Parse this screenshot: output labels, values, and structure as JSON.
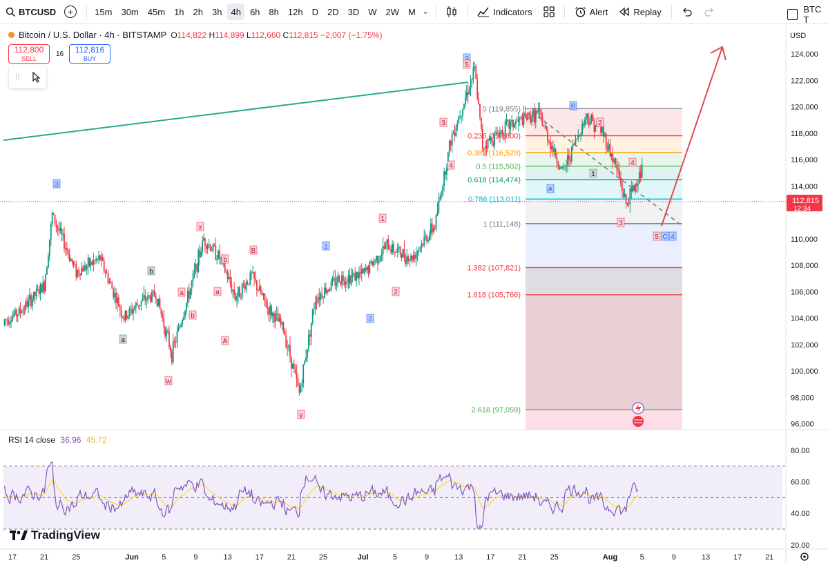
{
  "toolbar": {
    "symbol": "BTCUSD",
    "intervals": [
      "15m",
      "30m",
      "45m",
      "1h",
      "2h",
      "3h",
      "4h",
      "6h",
      "8h",
      "12h",
      "D",
      "2D",
      "3D",
      "W",
      "2W",
      "M"
    ],
    "active_interval": "4h",
    "indicators_label": "Indicators",
    "alert_label": "Alert",
    "replay_label": "Replay",
    "right_label": "BTC T"
  },
  "legend": {
    "title": "Bitcoin / U.S. Dollar · 4h · BITSTAMP",
    "open_label": "O",
    "open": "114,822",
    "high_label": "H",
    "high": "114,899",
    "low_label": "L",
    "low": "112,660",
    "close_label": "C",
    "close": "112,815",
    "change": "−2,007 (−1.75%)"
  },
  "trade": {
    "sell_price": "112,800",
    "sell_label": "SELL",
    "spread": "16",
    "buy_price": "112,816",
    "buy_label": "BUY"
  },
  "price_axis": {
    "currency": "USD",
    "ticks": [
      "124,000",
      "122,000",
      "120,000",
      "118,000",
      "116,000",
      "114,000",
      "112,000",
      "110,000",
      "108,000",
      "106,000",
      "104,000",
      "102,000",
      "100,000",
      "98,000",
      "96,000"
    ],
    "current_price": "112,815",
    "countdown": "12:34"
  },
  "time_axis": {
    "ticks": [
      "17",
      "21",
      "25",
      "Jun",
      "5",
      "9",
      "13",
      "17",
      "21",
      "25",
      "Jul",
      "5",
      "9",
      "13",
      "17",
      "21",
      "25",
      "Aug",
      "5",
      "9",
      "13",
      "17",
      "21"
    ]
  },
  "fib_levels": [
    {
      "label": "0 (119,855)",
      "color": "#787b86"
    },
    {
      "label": "0.236 (117,800)",
      "color": "#f23645"
    },
    {
      "label": "0.382 (116,529)",
      "color": "#ff9800"
    },
    {
      "label": "0.5 (115,502)",
      "color": "#4caf50"
    },
    {
      "label": "0.618 (114,474)",
      "color": "#089981"
    },
    {
      "label": "0.786 (113,011)",
      "color": "#00bcd4"
    },
    {
      "label": "1 (111,148)",
      "color": "#787b86"
    },
    {
      "label": "1.382 (107,821)",
      "color": "#f23645"
    },
    {
      "label": "1.618 (105,766)",
      "color": "#f23645"
    },
    {
      "label": "2.618 (97,059)",
      "color": "#4caf50"
    }
  ],
  "wave_labels": [
    {
      "text": "3",
      "style": "blue"
    },
    {
      "text": "5",
      "style": "red"
    },
    {
      "text": "3",
      "style": "red"
    },
    {
      "text": "4",
      "style": "red"
    },
    {
      "text": "B",
      "style": "blue"
    },
    {
      "text": "2",
      "style": "red"
    },
    {
      "text": "4",
      "style": "red"
    },
    {
      "text": "1",
      "style": "gray"
    },
    {
      "text": "A",
      "style": "blue"
    },
    {
      "text": "3",
      "style": "red"
    },
    {
      "text": "5",
      "style": "red"
    },
    {
      "text": "C",
      "style": "blue"
    },
    {
      "text": "4",
      "style": "blue"
    },
    {
      "text": "3",
      "style": "blue"
    },
    {
      "text": "x",
      "style": "red"
    },
    {
      "text": "b",
      "style": "red"
    },
    {
      "text": "B",
      "style": "red"
    },
    {
      "text": "a",
      "style": "red"
    },
    {
      "text": "b",
      "style": "red"
    },
    {
      "text": "b",
      "style": "gray"
    },
    {
      "text": "a",
      "style": "gray"
    },
    {
      "text": "a",
      "style": "red"
    },
    {
      "text": "A",
      "style": "red"
    },
    {
      "text": "w",
      "style": "red"
    },
    {
      "text": "y",
      "style": "red"
    },
    {
      "text": "1",
      "style": "blue"
    },
    {
      "text": "1",
      "style": "red"
    },
    {
      "text": "2",
      "style": "red"
    },
    {
      "text": "2",
      "style": "blue"
    }
  ],
  "rsi": {
    "label": "RSI 14 close",
    "value1": "36.96",
    "value2": "45.72",
    "ticks": [
      "80.00",
      "60.00",
      "40.00",
      "20.00"
    ]
  },
  "branding": {
    "name": "TradingView"
  },
  "colors": {
    "up": "#089981",
    "down": "#f23645",
    "rsi_line": "#7e57c2",
    "rsi_ma": "#fdd835",
    "trend": "#22ab94",
    "arrow": "#e0484f"
  },
  "chart_data": {
    "type": "candlestick",
    "symbol": "BTCUSD",
    "interval": "4h",
    "ylim": [
      96000,
      125000
    ],
    "close_path": [
      {
        "x": "May 15",
        "y": 103500
      },
      {
        "x": "May 18",
        "y": 104500
      },
      {
        "x": "May 21",
        "y": 106500
      },
      {
        "x": "May 22",
        "y": 111800
      },
      {
        "x": "May 25",
        "y": 107500
      },
      {
        "x": "May 28",
        "y": 108500
      },
      {
        "x": "May 31",
        "y": 104000
      },
      {
        "x": "Jun 2",
        "y": 105200
      },
      {
        "x": "Jun 4",
        "y": 105800
      },
      {
        "x": "Jun 6",
        "y": 101300
      },
      {
        "x": "Jun 8",
        "y": 105500
      },
      {
        "x": "Jun 10",
        "y": 110000
      },
      {
        "x": "Jun 12",
        "y": 108600
      },
      {
        "x": "Jun 14",
        "y": 105600
      },
      {
        "x": "Jun 16",
        "y": 107200
      },
      {
        "x": "Jun 18",
        "y": 104800
      },
      {
        "x": "Jun 20",
        "y": 103200
      },
      {
        "x": "Jun 22",
        "y": 98300
      },
      {
        "x": "Jun 24",
        "y": 105500
      },
      {
        "x": "Jun 27",
        "y": 107000
      },
      {
        "x": "Jun 30",
        "y": 107300
      },
      {
        "x": "Jul 3",
        "y": 109500
      },
      {
        "x": "Jul 6",
        "y": 108500
      },
      {
        "x": "Jul 9",
        "y": 111000
      },
      {
        "x": "Jul 11",
        "y": 117500
      },
      {
        "x": "Jul 14",
        "y": 122800
      },
      {
        "x": "Jul 15",
        "y": 117000
      },
      {
        "x": "Jul 18",
        "y": 118500
      },
      {
        "x": "Jul 22",
        "y": 119500
      },
      {
        "x": "Jul 25",
        "y": 115000
      },
      {
        "x": "Jul 28",
        "y": 119300
      },
      {
        "x": "Jul 30",
        "y": 118200
      },
      {
        "x": "Aug 1",
        "y": 115000
      },
      {
        "x": "Aug 2",
        "y": 112600
      },
      {
        "x": "Aug 4",
        "y": 115200
      },
      {
        "x": "Aug 6",
        "y": 112815
      }
    ],
    "annotations": {
      "projection_arrow_target": 124000,
      "projection_arrow_start": 111148
    }
  }
}
